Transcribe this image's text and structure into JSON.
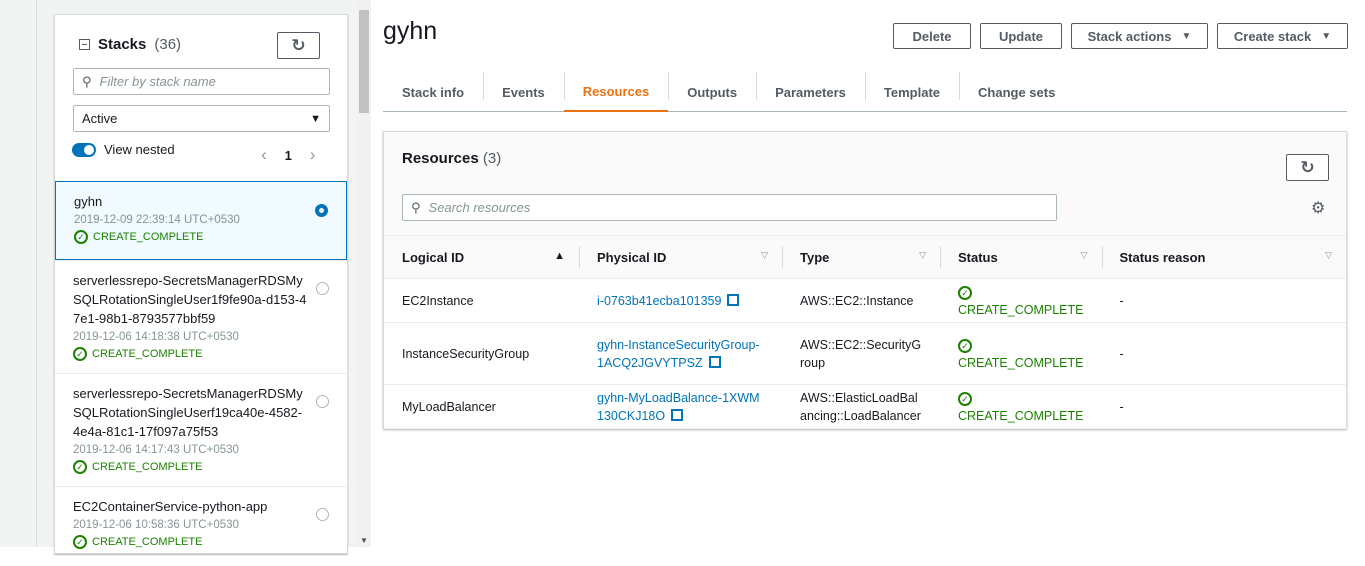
{
  "sidebar": {
    "title": "Stacks",
    "count": "(36)",
    "filter_placeholder": "Filter by stack name",
    "status_filter": "Active",
    "view_nested": "View nested",
    "page": "1",
    "stacks": [
      {
        "name": "gyhn",
        "date": "2019-12-09 22:39:14 UTC+0530",
        "status": "CREATE_COMPLETE"
      },
      {
        "name": "serverlessrepo-SecretsManagerRDSMySQLRotationSingleUser1f9fe90a-d153-47e1-98b1-8793577bbf59",
        "date": "2019-12-06 14:18:38 UTC+0530",
        "status": "CREATE_COMPLETE"
      },
      {
        "name": "serverlessrepo-SecretsManagerRDSMySQLRotationSingleUserf19ca40e-4582-4e4a-81c1-17f097a75f53",
        "date": "2019-12-06 14:17:43 UTC+0530",
        "status": "CREATE_COMPLETE"
      },
      {
        "name": "EC2ContainerService-python-app",
        "date": "2019-12-06 10:58:36 UTC+0530",
        "status": "CREATE_COMPLETE"
      }
    ]
  },
  "header": {
    "title": "gyhn",
    "delete": "Delete",
    "update": "Update",
    "stack_actions": "Stack actions",
    "create_stack": "Create stack"
  },
  "tabs": [
    "Stack info",
    "Events",
    "Resources",
    "Outputs",
    "Parameters",
    "Template",
    "Change sets"
  ],
  "resources": {
    "title": "Resources",
    "count": "(3)",
    "search_placeholder": "Search resources",
    "columns": [
      "Logical ID",
      "Physical ID",
      "Type",
      "Status",
      "Status reason"
    ],
    "rows": [
      {
        "logical": "EC2Instance",
        "physical": "i-0763b41ecba101359",
        "type": "AWS::EC2::Instance",
        "status": "CREATE_COMPLETE",
        "reason": "-"
      },
      {
        "logical": "InstanceSecurityGroup",
        "physical": "gyhn-InstanceSecurityGroup-1ACQ2JGVYTPSZ",
        "type": "AWS::EC2::SecurityGroup",
        "status": "CREATE_COMPLETE",
        "reason": "-"
      },
      {
        "logical": "MyLoadBalancer",
        "physical": "gyhn-MyLoadBalance-1XWM130CKJ18O",
        "type": "AWS::ElasticLoadBalancing::LoadBalancer",
        "status": "CREATE_COMPLETE",
        "reason": "-"
      }
    ]
  }
}
